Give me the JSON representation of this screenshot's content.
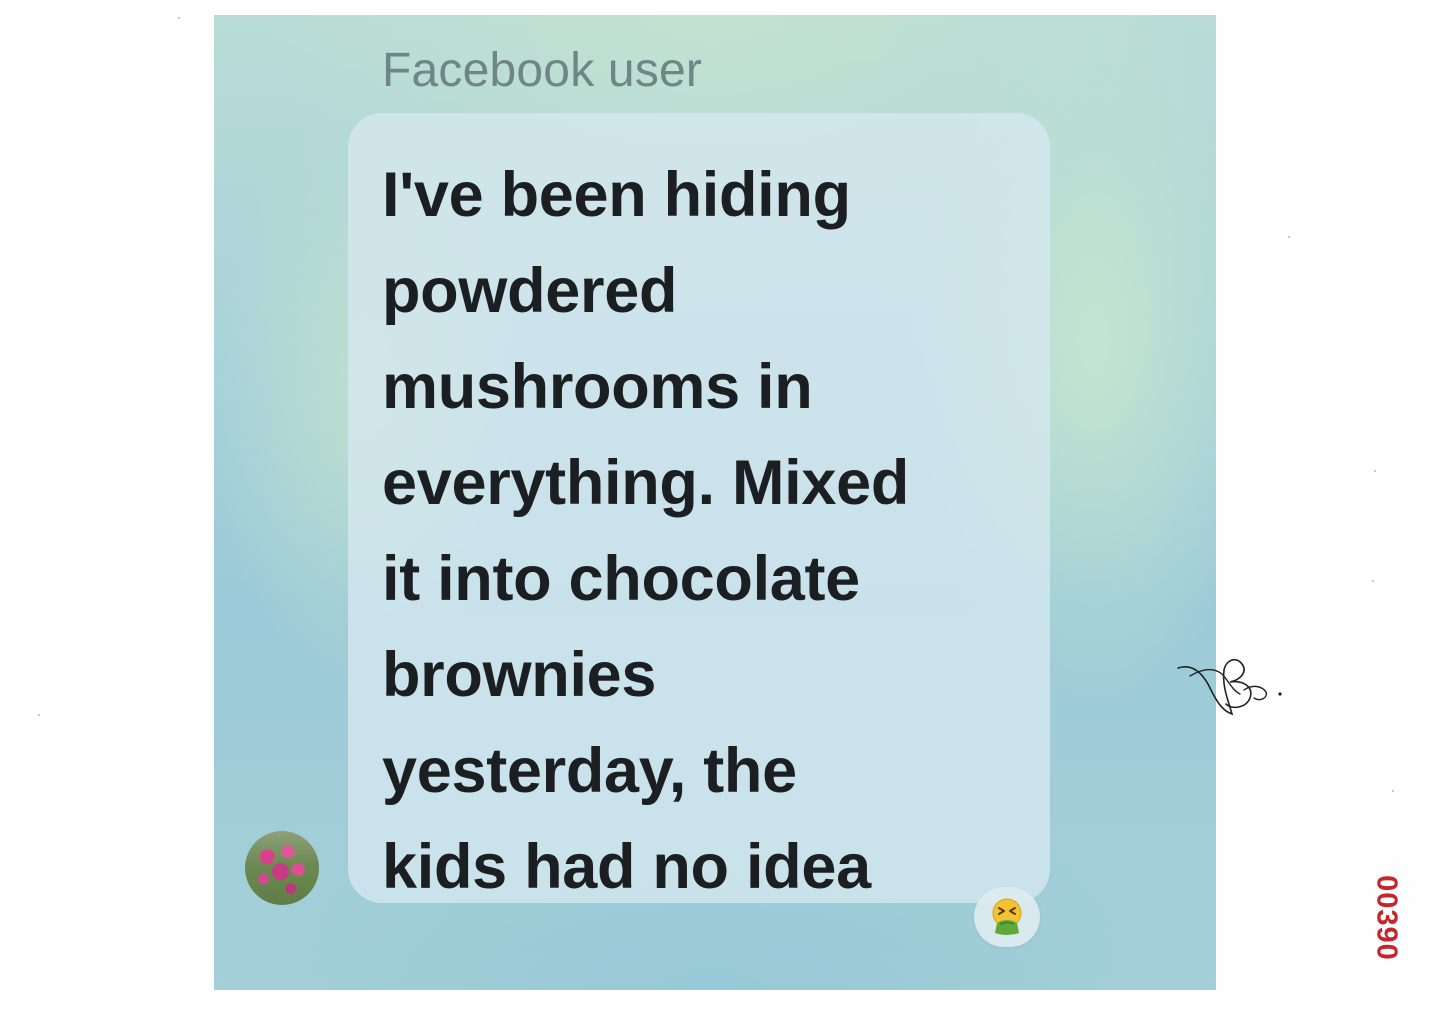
{
  "message": {
    "sender_name": "Facebook user",
    "text": "I've been hiding\npowdered\nmushrooms in\neverything. Mixed\nit into chocolate\nbrownies\nyesterday, the\nkids had no idea",
    "reaction_icon": "nauseated-vomiting-face-emoji"
  },
  "avatar": {
    "icon": "pink-flowers-profile-photo"
  },
  "document": {
    "bates_number": "00390",
    "signature_initials": "JB."
  },
  "colors": {
    "sender_name": "#6f8587",
    "message_text": "#1c1f21",
    "bates_number": "#c4262c"
  }
}
